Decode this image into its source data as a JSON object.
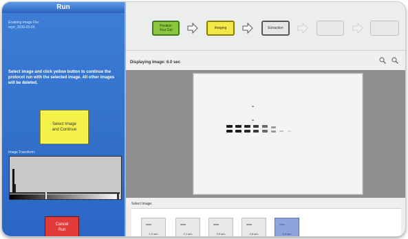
{
  "left_panel": {
    "title": "Run",
    "info_line1": "Enabling Image File:",
    "info_line2": "myrr_2030-03-24",
    "instructions": "Select image and click yellow button to continue the protocol run with the selected image. All other images will be deleted.",
    "select_button_line1": "Select Image",
    "select_button_line2": "and Continue",
    "histogram_label": "Image Transform:",
    "cancel_line1": "Cancel",
    "cancel_line2": "Run"
  },
  "workflow": {
    "steps": [
      {
        "line1": "Position",
        "line2": "Your Gel",
        "state": "done"
      },
      {
        "line1": "Imaging",
        "line2": "",
        "state": "active"
      },
      {
        "line1": "Extraction",
        "line2": "",
        "state": "pending"
      },
      {
        "line1": "",
        "line2": "",
        "state": "disabled"
      },
      {
        "line1": "",
        "line2": "",
        "state": "disabled"
      }
    ],
    "colors": {
      "done": "#8cc63f",
      "active": "#f2e84a",
      "pending": "#e6e6e6",
      "disabled": "#e8e8e8"
    }
  },
  "viewer": {
    "displaying_label": "Displaying Image: 6.0 sec",
    "zoom_in_icon": "zoom-in-icon",
    "zoom_out_icon": "zoom-out-icon"
  },
  "thumbnails": {
    "label": "Select Image:",
    "items": [
      {
        "caption": "1.0 sec",
        "selected": false
      },
      {
        "caption": "2.1 sec",
        "selected": false
      },
      {
        "caption": "3.5 sec",
        "selected": false
      },
      {
        "caption": "4.8 sec",
        "selected": false
      },
      {
        "caption": "6.0 sec",
        "selected": true
      }
    ]
  }
}
